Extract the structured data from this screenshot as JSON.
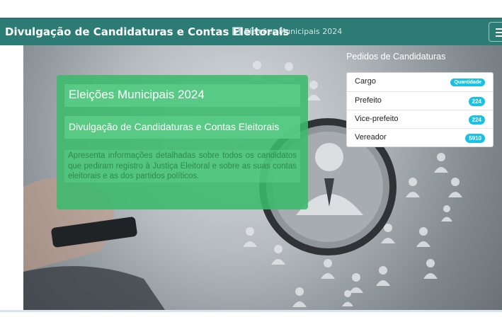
{
  "header": {
    "brand": "Divulgação de Candidaturas e Contas Eleitorais",
    "subnav": "Eleições Municipais 2024",
    "edit_icon": "edit-icon",
    "menu_icon": "hamburger-icon"
  },
  "hero": {
    "title": "Eleições Municipais 2024",
    "subtitle": "Divulgação de Candidaturas e Contas Eleitorais",
    "description": "Apresenta informações detalhadas sobre todos os candidatos que pediram registro à Justiça Eleitoral e sobre as suas contas eleitorais e as dos partidos políticos."
  },
  "requests": {
    "title": "Pedidos de Candidaturas",
    "header": {
      "label": "Cargo",
      "badge": "Quantidade"
    },
    "rows": [
      {
        "label": "Prefeito",
        "count": "224"
      },
      {
        "label": "Vice-prefeito",
        "count": "224"
      },
      {
        "label": "Vereador",
        "count": "5910"
      }
    ]
  },
  "colors": {
    "navbar": "#2d7b75",
    "hero_box": "#3cb96c",
    "badge": "#18c2e4"
  }
}
